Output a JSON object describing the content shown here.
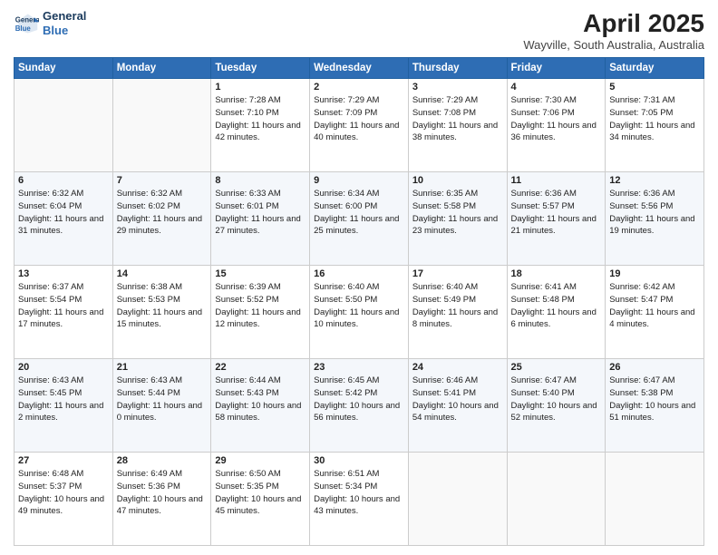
{
  "header": {
    "logo_line1": "General",
    "logo_line2": "Blue",
    "title": "April 2025",
    "subtitle": "Wayville, South Australia, Australia"
  },
  "weekdays": [
    "Sunday",
    "Monday",
    "Tuesday",
    "Wednesday",
    "Thursday",
    "Friday",
    "Saturday"
  ],
  "weeks": [
    [
      {
        "day": "",
        "info": ""
      },
      {
        "day": "",
        "info": ""
      },
      {
        "day": "1",
        "info": "Sunrise: 7:28 AM\nSunset: 7:10 PM\nDaylight: 11 hours and 42 minutes."
      },
      {
        "day": "2",
        "info": "Sunrise: 7:29 AM\nSunset: 7:09 PM\nDaylight: 11 hours and 40 minutes."
      },
      {
        "day": "3",
        "info": "Sunrise: 7:29 AM\nSunset: 7:08 PM\nDaylight: 11 hours and 38 minutes."
      },
      {
        "day": "4",
        "info": "Sunrise: 7:30 AM\nSunset: 7:06 PM\nDaylight: 11 hours and 36 minutes."
      },
      {
        "day": "5",
        "info": "Sunrise: 7:31 AM\nSunset: 7:05 PM\nDaylight: 11 hours and 34 minutes."
      }
    ],
    [
      {
        "day": "6",
        "info": "Sunrise: 6:32 AM\nSunset: 6:04 PM\nDaylight: 11 hours and 31 minutes."
      },
      {
        "day": "7",
        "info": "Sunrise: 6:32 AM\nSunset: 6:02 PM\nDaylight: 11 hours and 29 minutes."
      },
      {
        "day": "8",
        "info": "Sunrise: 6:33 AM\nSunset: 6:01 PM\nDaylight: 11 hours and 27 minutes."
      },
      {
        "day": "9",
        "info": "Sunrise: 6:34 AM\nSunset: 6:00 PM\nDaylight: 11 hours and 25 minutes."
      },
      {
        "day": "10",
        "info": "Sunrise: 6:35 AM\nSunset: 5:58 PM\nDaylight: 11 hours and 23 minutes."
      },
      {
        "day": "11",
        "info": "Sunrise: 6:36 AM\nSunset: 5:57 PM\nDaylight: 11 hours and 21 minutes."
      },
      {
        "day": "12",
        "info": "Sunrise: 6:36 AM\nSunset: 5:56 PM\nDaylight: 11 hours and 19 minutes."
      }
    ],
    [
      {
        "day": "13",
        "info": "Sunrise: 6:37 AM\nSunset: 5:54 PM\nDaylight: 11 hours and 17 minutes."
      },
      {
        "day": "14",
        "info": "Sunrise: 6:38 AM\nSunset: 5:53 PM\nDaylight: 11 hours and 15 minutes."
      },
      {
        "day": "15",
        "info": "Sunrise: 6:39 AM\nSunset: 5:52 PM\nDaylight: 11 hours and 12 minutes."
      },
      {
        "day": "16",
        "info": "Sunrise: 6:40 AM\nSunset: 5:50 PM\nDaylight: 11 hours and 10 minutes."
      },
      {
        "day": "17",
        "info": "Sunrise: 6:40 AM\nSunset: 5:49 PM\nDaylight: 11 hours and 8 minutes."
      },
      {
        "day": "18",
        "info": "Sunrise: 6:41 AM\nSunset: 5:48 PM\nDaylight: 11 hours and 6 minutes."
      },
      {
        "day": "19",
        "info": "Sunrise: 6:42 AM\nSunset: 5:47 PM\nDaylight: 11 hours and 4 minutes."
      }
    ],
    [
      {
        "day": "20",
        "info": "Sunrise: 6:43 AM\nSunset: 5:45 PM\nDaylight: 11 hours and 2 minutes."
      },
      {
        "day": "21",
        "info": "Sunrise: 6:43 AM\nSunset: 5:44 PM\nDaylight: 11 hours and 0 minutes."
      },
      {
        "day": "22",
        "info": "Sunrise: 6:44 AM\nSunset: 5:43 PM\nDaylight: 10 hours and 58 minutes."
      },
      {
        "day": "23",
        "info": "Sunrise: 6:45 AM\nSunset: 5:42 PM\nDaylight: 10 hours and 56 minutes."
      },
      {
        "day": "24",
        "info": "Sunrise: 6:46 AM\nSunset: 5:41 PM\nDaylight: 10 hours and 54 minutes."
      },
      {
        "day": "25",
        "info": "Sunrise: 6:47 AM\nSunset: 5:40 PM\nDaylight: 10 hours and 52 minutes."
      },
      {
        "day": "26",
        "info": "Sunrise: 6:47 AM\nSunset: 5:38 PM\nDaylight: 10 hours and 51 minutes."
      }
    ],
    [
      {
        "day": "27",
        "info": "Sunrise: 6:48 AM\nSunset: 5:37 PM\nDaylight: 10 hours and 49 minutes."
      },
      {
        "day": "28",
        "info": "Sunrise: 6:49 AM\nSunset: 5:36 PM\nDaylight: 10 hours and 47 minutes."
      },
      {
        "day": "29",
        "info": "Sunrise: 6:50 AM\nSunset: 5:35 PM\nDaylight: 10 hours and 45 minutes."
      },
      {
        "day": "30",
        "info": "Sunrise: 6:51 AM\nSunset: 5:34 PM\nDaylight: 10 hours and 43 minutes."
      },
      {
        "day": "",
        "info": ""
      },
      {
        "day": "",
        "info": ""
      },
      {
        "day": "",
        "info": ""
      }
    ]
  ]
}
